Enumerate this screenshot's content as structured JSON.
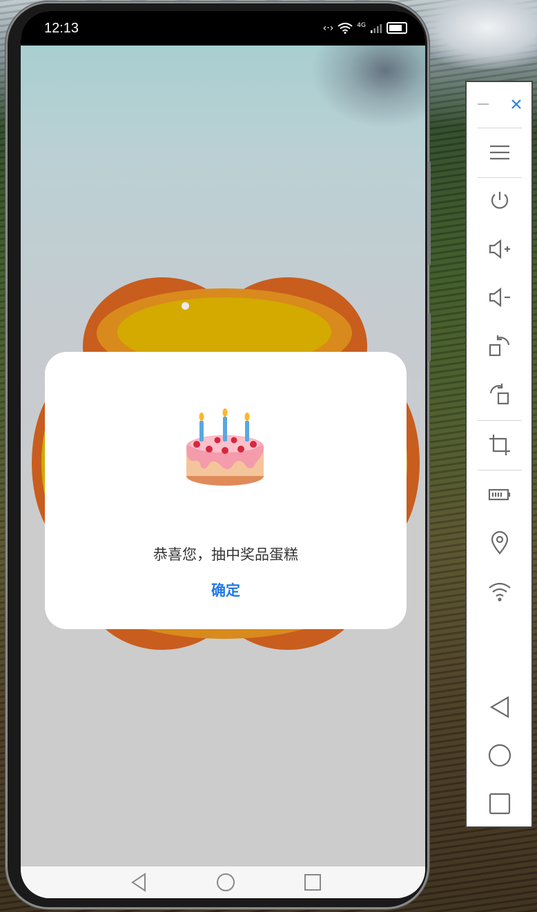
{
  "status_bar": {
    "time": "12:13",
    "network": "4G"
  },
  "dialog": {
    "message": "恭喜您，抽中奖品蛋糕",
    "confirm_label": "确定",
    "image_icon": "birthday-cake"
  },
  "emulator_toolbar": {
    "buttons": [
      "minimize",
      "close",
      "menu",
      "power",
      "volume-up",
      "volume-down",
      "rotate-right",
      "rotate-left",
      "crop",
      "battery",
      "location",
      "wifi",
      "back",
      "home",
      "recents"
    ]
  },
  "colors": {
    "accent": "#1f7ae6",
    "wheel_outer": "#c85d1e",
    "wheel_mid": "#d98a1c",
    "wheel_inner": "#d4a900"
  }
}
